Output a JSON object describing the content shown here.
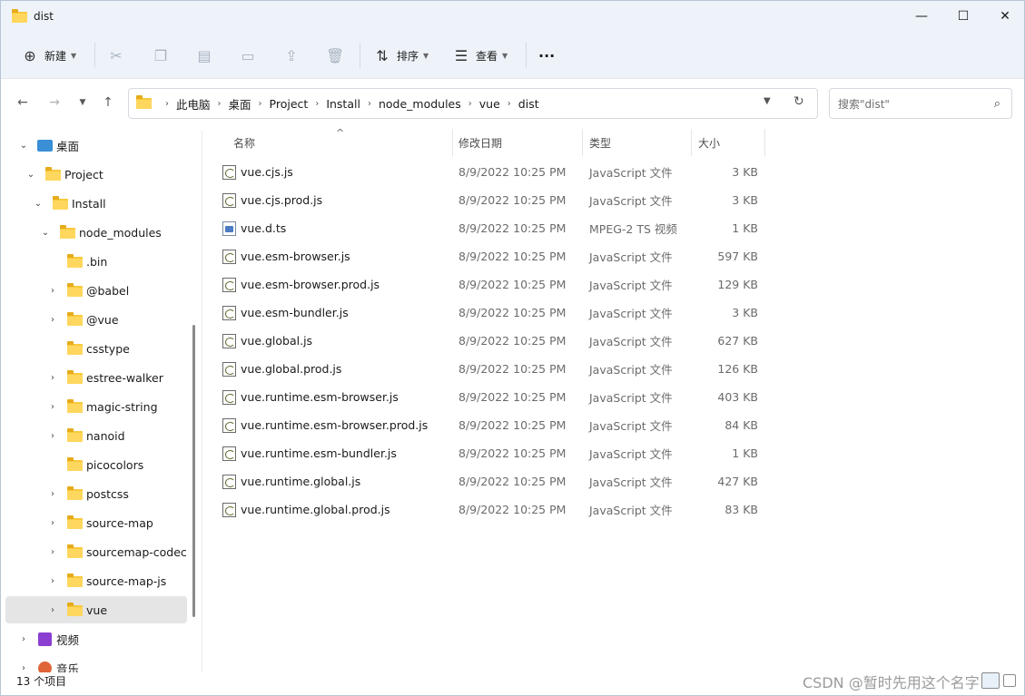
{
  "window": {
    "title": "dist"
  },
  "controls": {
    "minimize": "—",
    "maximize": "☐",
    "close": "✕"
  },
  "toolbar": {
    "new_label": "新建",
    "sort_label": "排序",
    "view_label": "查看",
    "more_label": "···"
  },
  "breadcrumb": [
    "此电脑",
    "桌面",
    "Project",
    "Install",
    "node_modules",
    "vue",
    "dist"
  ],
  "search": {
    "placeholder": "搜索\"dist\""
  },
  "tree": [
    {
      "label": "桌面",
      "expanded": true,
      "icon": "desktop-icon"
    },
    {
      "label": "Project",
      "expanded": true,
      "icon": "folder-icon"
    },
    {
      "label": "Install",
      "expanded": true,
      "icon": "folder-icon"
    },
    {
      "label": "node_modules",
      "expanded": true,
      "icon": "folder-icon"
    },
    {
      "label": ".bin",
      "icon": "folder-icon"
    },
    {
      "label": "@babel",
      "icon": "folder-icon"
    },
    {
      "label": "@vue",
      "icon": "folder-icon"
    },
    {
      "label": "csstype",
      "icon": "folder-icon"
    },
    {
      "label": "estree-walker",
      "icon": "folder-icon"
    },
    {
      "label": "magic-string",
      "icon": "folder-icon"
    },
    {
      "label": "nanoid",
      "icon": "folder-icon"
    },
    {
      "label": "picocolors",
      "icon": "folder-icon"
    },
    {
      "label": "postcss",
      "icon": "folder-icon"
    },
    {
      "label": "source-map",
      "icon": "folder-icon"
    },
    {
      "label": "sourcemap-codec",
      "icon": "folder-icon"
    },
    {
      "label": "source-map-js",
      "icon": "folder-icon"
    },
    {
      "label": "vue",
      "icon": "folder-icon",
      "selected": true
    },
    {
      "label": "视频",
      "icon": "videos-icon"
    },
    {
      "label": "音乐",
      "icon": "music-icon"
    }
  ],
  "columns": {
    "name": "名称",
    "date": "修改日期",
    "type": "类型",
    "size": "大小"
  },
  "files": [
    {
      "name": "vue.cjs.js",
      "date": "8/9/2022 10:25 PM",
      "type": "JavaScript 文件",
      "size": "3 KB"
    },
    {
      "name": "vue.cjs.prod.js",
      "date": "8/9/2022 10:25 PM",
      "type": "JavaScript 文件",
      "size": "3 KB"
    },
    {
      "name": "vue.d.ts",
      "date": "8/9/2022 10:25 PM",
      "type": "MPEG-2 TS 视频",
      "size": "1 KB"
    },
    {
      "name": "vue.esm-browser.js",
      "date": "8/9/2022 10:25 PM",
      "type": "JavaScript 文件",
      "size": "597 KB"
    },
    {
      "name": "vue.esm-browser.prod.js",
      "date": "8/9/2022 10:25 PM",
      "type": "JavaScript 文件",
      "size": "129 KB"
    },
    {
      "name": "vue.esm-bundler.js",
      "date": "8/9/2022 10:25 PM",
      "type": "JavaScript 文件",
      "size": "3 KB"
    },
    {
      "name": "vue.global.js",
      "date": "8/9/2022 10:25 PM",
      "type": "JavaScript 文件",
      "size": "627 KB"
    },
    {
      "name": "vue.global.prod.js",
      "date": "8/9/2022 10:25 PM",
      "type": "JavaScript 文件",
      "size": "126 KB"
    },
    {
      "name": "vue.runtime.esm-browser.js",
      "date": "8/9/2022 10:25 PM",
      "type": "JavaScript 文件",
      "size": "403 KB"
    },
    {
      "name": "vue.runtime.esm-browser.prod.js",
      "date": "8/9/2022 10:25 PM",
      "type": "JavaScript 文件",
      "size": "84 KB"
    },
    {
      "name": "vue.runtime.esm-bundler.js",
      "date": "8/9/2022 10:25 PM",
      "type": "JavaScript 文件",
      "size": "1 KB"
    },
    {
      "name": "vue.runtime.global.js",
      "date": "8/9/2022 10:25 PM",
      "type": "JavaScript 文件",
      "size": "427 KB"
    },
    {
      "name": "vue.runtime.global.prod.js",
      "date": "8/9/2022 10:25 PM",
      "type": "JavaScript 文件",
      "size": "83 KB"
    }
  ],
  "status": {
    "count": "13 个项目"
  },
  "watermark": "CSDN @暂时先用这个名字"
}
